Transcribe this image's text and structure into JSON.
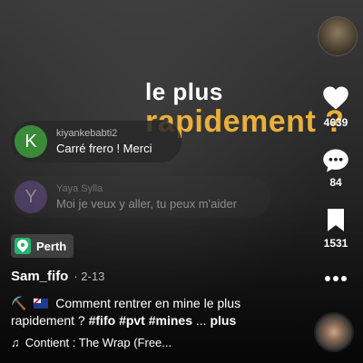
{
  "overlay": {
    "line1": "le plus",
    "line2": "rapidement ?"
  },
  "comments": [
    {
      "avatar_letter": "K",
      "user": "kiyankebabti2",
      "text": "Carré frero ! Merci"
    },
    {
      "avatar_letter": "Y",
      "user": "Yaya Sylla",
      "text": "Moi je veux y aller, tu peux m'aider"
    }
  ],
  "rail": {
    "likes": "4639",
    "comments": "84",
    "saves": "1531"
  },
  "location": "Perth",
  "author": {
    "name": "Sam_fifo",
    "date": "· 2-13"
  },
  "caption": {
    "pick": "⛏️",
    "text": "Comment rentrer en mine le plus rapidement ?",
    "tags": [
      "#fifo",
      "#pvt",
      "#mines"
    ],
    "ellipsis": "...",
    "more": "plus"
  },
  "music": {
    "note": "♫",
    "text": "Contient : The Wrap (Free..."
  },
  "colors": {
    "accent": "#e9b03a",
    "location": "#22b573"
  }
}
